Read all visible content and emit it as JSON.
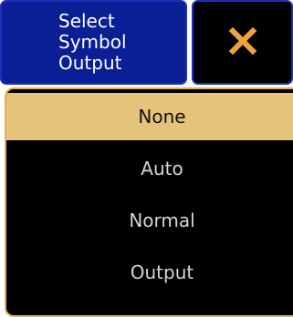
{
  "dialog": {
    "title": "Select\nSymbol\nOutput",
    "close_icon": "close-x-icon"
  },
  "options": [
    {
      "label": "None",
      "selected": true
    },
    {
      "label": "Auto",
      "selected": false
    },
    {
      "label": "Normal",
      "selected": false
    },
    {
      "label": "Output",
      "selected": false
    }
  ],
  "colors": {
    "title_bg": "#0a1f95",
    "border_blue": "#1f2fb8",
    "panel_border": "#e4b04f",
    "selected_bg": "#e6c37a",
    "close_x": "#f1a13a",
    "option_text": "#d4d4d4"
  }
}
